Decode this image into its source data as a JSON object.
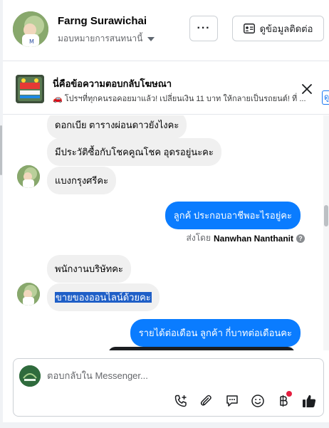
{
  "header": {
    "name": "Farng Surawichai",
    "assignment": "มอบหมายการสนทนานี้",
    "more_label": "···",
    "contact_label": "ดูข้อมูลติดต่อ"
  },
  "ad": {
    "title": "นี่คือข้อความตอบกลับโฆษณา",
    "text": "🚗 โปรฯที่ทุกคนรอคอยมาแล้ว! เปลี่ยนเงิน 11 บาท ให้กลายเป็นรถยนต์! ที่ ...",
    "edge_label": "ดู"
  },
  "messages": {
    "m1": "ดอกเบีย ตารางผ่อนดาวยังไงคะ",
    "m2": "มีประวัติซื้อกับโชคคูณโชค อุดรอยู่นะคะ",
    "m3": "แบงกรุงศรีคะ",
    "m4": "ลูกค้ ประกอบอาชีพอะไรอยู่คะ",
    "sent_by_prefix": "ส่งโดย",
    "sent_by_name": "Nanwhan Nanthanit",
    "info": "?",
    "m5": "พนักงานบริษัทคะ",
    "m6": "ขายของออนไลน์ด้วยคะ",
    "m7": "รายได้ต่อเดือน ลูกค้า กี่บาทต่อเดือนคะ"
  },
  "composer": {
    "placeholder": "ตอบกลับใน Messenger..."
  },
  "icons": {
    "call": "phone-plus-icon",
    "attach": "paperclip-icon",
    "saved_replies": "chat-bubble-icon",
    "emoji": "smiley-icon",
    "payment": "baht-icon",
    "like": "thumbs-up-icon"
  },
  "colors": {
    "outgoing_bubble": "#0a7cff",
    "incoming_bubble": "#f0f0f0",
    "selection": "#1f5fc7",
    "like": "#1877f2",
    "badge": "#e41e3f"
  }
}
